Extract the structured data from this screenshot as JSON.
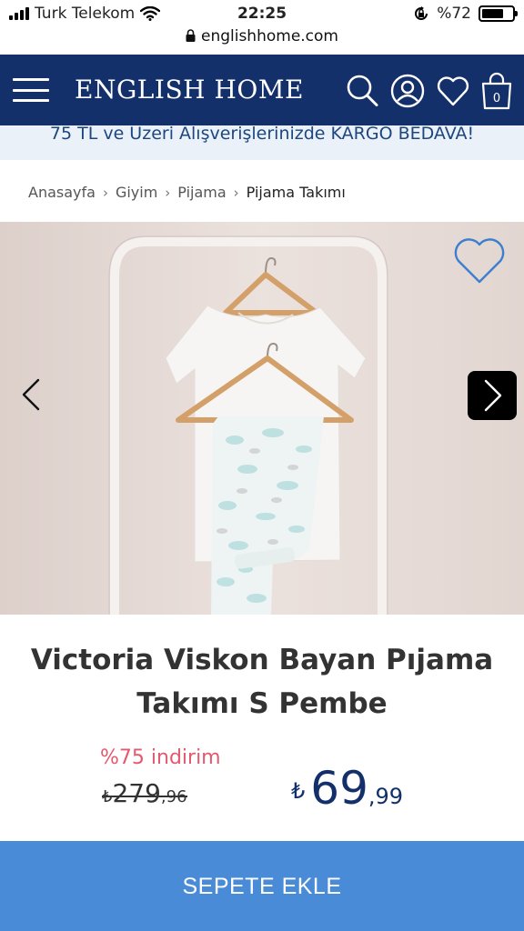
{
  "status_bar": {
    "carrier": "Turk Telekom",
    "time": "22:25",
    "battery": "%72",
    "battery_level": 0.72,
    "icons": [
      "signal-icon",
      "wifi-icon",
      "orientation-lock-icon",
      "battery-icon"
    ]
  },
  "browser": {
    "url": "englishhome.com"
  },
  "header": {
    "logo": "ENGLISH HOME",
    "cart_count": "0",
    "background": "#13306b",
    "icons": [
      "menu-icon",
      "search-icon",
      "user-icon",
      "heart-icon",
      "cart-icon"
    ]
  },
  "promo": {
    "text": "75 TL ve Üzeri Alışverişlerinizde KARGO BEDAVA!"
  },
  "breadcrumb": [
    {
      "label": "Anasayfa"
    },
    {
      "label": "Giyim"
    },
    {
      "label": "Pijama"
    },
    {
      "label": "Pijama Takımı"
    }
  ],
  "product": {
    "title_line1": "Victoria Viskon Bayan Pıjama",
    "title_line2": "Takımı S Pembe",
    "discount": "%75 indirim",
    "old_price": {
      "currency": "₺",
      "int": "279",
      "dec": ",96"
    },
    "new_price": {
      "currency": "₺",
      "int": "69",
      "dec": ",99"
    },
    "image_icons": [
      "heart-outline-icon",
      "chevron-left-icon",
      "chevron-right-icon"
    ]
  },
  "cta": {
    "label": "SEPETE EKLE",
    "color": "#4a8bd8"
  },
  "colors": {
    "discount": "#e5596e",
    "price": "#13306b",
    "promo_bg": "#eaf1f9"
  }
}
